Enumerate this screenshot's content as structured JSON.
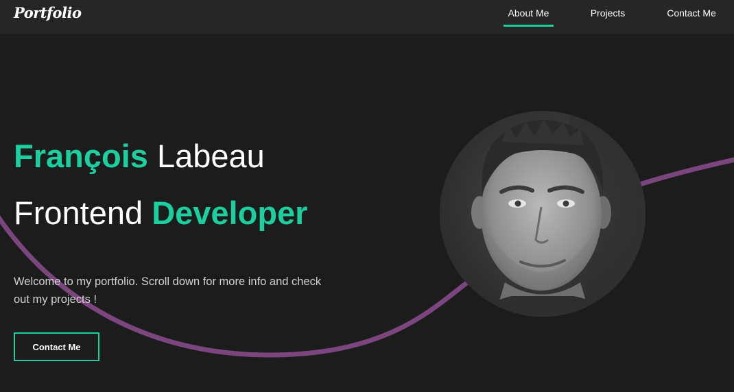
{
  "nav": {
    "logo": "Portfolio",
    "items": [
      {
        "label": "About Me",
        "active": true
      },
      {
        "label": "Projects",
        "active": false
      },
      {
        "label": "Contact Me",
        "active": false
      }
    ]
  },
  "hero": {
    "name_first": "François",
    "name_last": "Labeau",
    "title_first": "Frontend",
    "title_second": "Developer",
    "subtitle": "Welcome to my portfolio. Scroll down for more info and check out my projects !",
    "cta_label": "Contact Me",
    "avatar_icon": "profile-photo"
  },
  "colors": {
    "accent": "#1ccf9e",
    "wave": "#7b467e",
    "background": "#1c1c1d",
    "navbar": "#262627"
  }
}
